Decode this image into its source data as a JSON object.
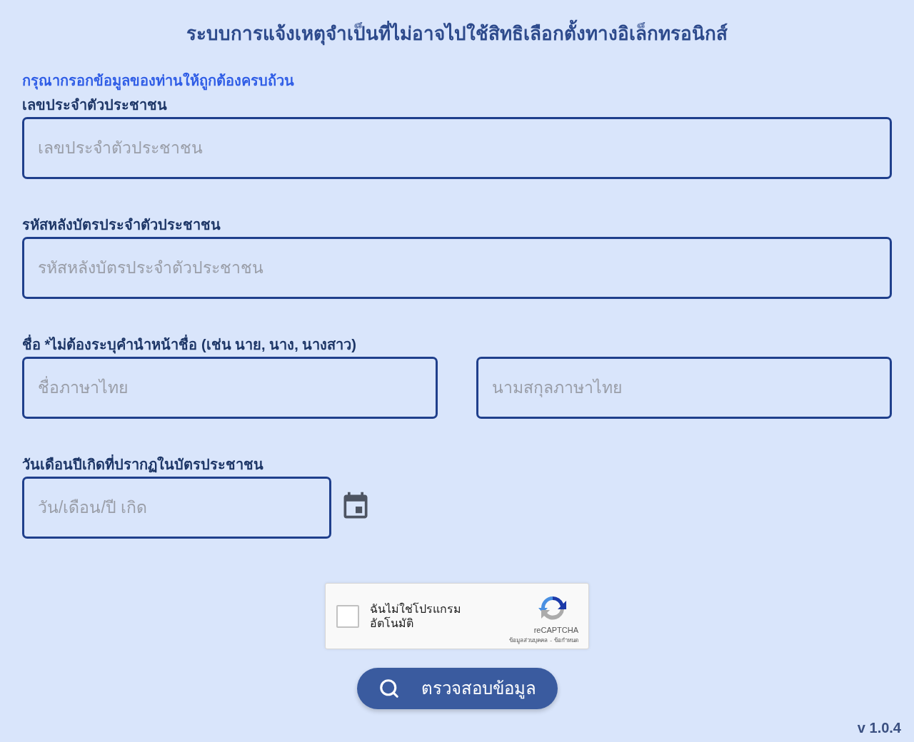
{
  "title": "ระบบการแจ้งเหตุจำเป็นที่ไม่อาจไปใช้สิทธิเลือกตั้งทางอิเล็กทรอนิกส์",
  "instruction": "กรุณากรอกข้อมูลของท่านให้ถูกต้องครบถ้วน",
  "fields": [
    {
      "kind": "full",
      "label": "เลขประจำตัวประชาชน",
      "inputs": [
        {
          "placeholder": "เลขประจำตัวประชาชน"
        }
      ]
    },
    {
      "kind": "full",
      "label": "รหัสหลังบัตรประจำตัวประชาชน",
      "inputs": [
        {
          "placeholder": "รหัสหลังบัตรประจำตัวประชาชน"
        }
      ]
    },
    {
      "kind": "pair",
      "label": "ชื่อ *ไม่ต้องระบุคำนำหน้าชื่อ (เช่น นาย, นาง, นางสาว)",
      "inputs": [
        {
          "placeholder": "ชื่อภาษาไทย"
        },
        {
          "placeholder": "นามสกุลภาษาไทย"
        }
      ]
    },
    {
      "kind": "date",
      "label": "วันเดือนปีเกิดที่ปรากฏในบัตรประชาชน",
      "inputs": [
        {
          "placeholder": "วัน/เดือน/ปี เกิด"
        }
      ]
    }
  ],
  "captcha": {
    "checked": false,
    "label": "ฉันไม่ใช่โปรแกรมอัตโนมัติ",
    "brand": "reCAPTCHA",
    "links": [
      "ข้อมูลส่วนบุคคล",
      "ข้อกำหนด"
    ],
    "separator": "-"
  },
  "submit_button": {
    "label": "ตรวจสอบข้อมูล"
  },
  "version": "v 1.0.4"
}
